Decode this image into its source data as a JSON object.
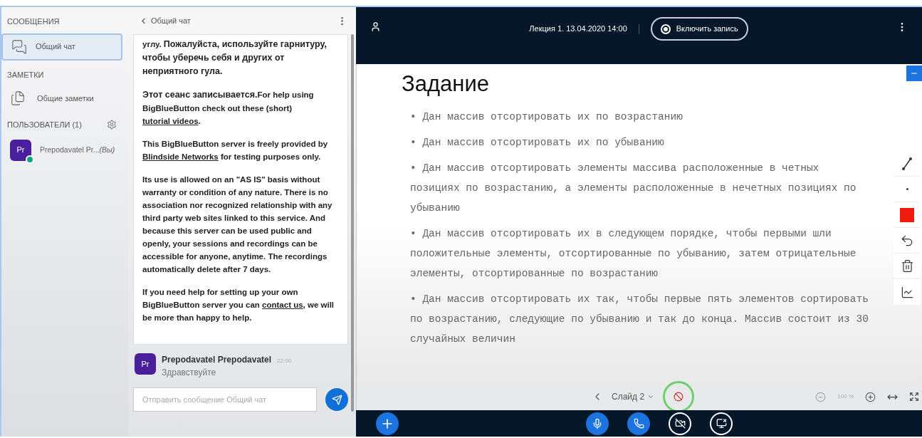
{
  "sidebar": {
    "messages_heading": "СООБЩЕНИЯ",
    "chats": [
      {
        "label": "Общий чат",
        "selected": true
      }
    ],
    "notes_heading": "ЗАМЕТКИ",
    "notes": [
      {
        "label": "Общие заметки"
      }
    ],
    "users_heading": "ПОЛЬЗОВАТЕЛИ (1)",
    "users": [
      {
        "avatar": "Pr",
        "name": "Prepodavatel Pr...",
        "suffix": "(Вы)"
      }
    ]
  },
  "chat": {
    "title": "Общий чат",
    "welcome": [
      [
        {
          "kind": "plain",
          "text": "углу. "
        },
        {
          "kind": "bold",
          "text": "Пожалуйста, используйте гарнитуру, чтобы уберечь себя и других от неприятного гула."
        }
      ],
      [
        {
          "kind": "bold",
          "text": "Этот сеанс записывается."
        },
        {
          "kind": "plain",
          "text": "For help using BigBlueButton check out these (short) "
        },
        {
          "kind": "link",
          "text": "tutorial videos"
        },
        {
          "kind": "plain",
          "text": "."
        }
      ],
      [
        {
          "kind": "plain",
          "text": "This BigBlueButton server is freely provided by "
        },
        {
          "kind": "link",
          "text": "Blindside Networks"
        },
        {
          "kind": "plain",
          "text": " for testing purposes only."
        }
      ],
      [
        {
          "kind": "plain",
          "text": "Its use is allowed on an \"AS IS\" basis without warranty or condition of any nature. There is no association nor recognized relationship with any third party web sites linked to this service. And because this server can be used public and openly, your sessions and recordings can be accessible for anyone, anytime. The recordings automatically delete after 7 days."
        }
      ],
      [
        {
          "kind": "plain",
          "text": "If you need help for setting up your own BigBlueButton server you can "
        },
        {
          "kind": "link",
          "text": "contact us"
        },
        {
          "kind": "plain",
          "text": ", we will be more than happy to help."
        }
      ]
    ],
    "messages": [
      {
        "avatar": "Pr",
        "author": "Prepodavatel Prepodavatel",
        "time": "22:00",
        "text": "Здравствуйте"
      }
    ],
    "input": {
      "placeholder": "Отправить сообщение Общий чат"
    }
  },
  "header": {
    "title": "Лекция 1. 13.04.2020 14:00",
    "record_button": "Включить запись"
  },
  "slide": {
    "title": "Задание",
    "items": [
      "• Дан массив отсортировать их по возрастанию",
      "• Дан массив отсортировать их по убыванию",
      "• Дан массив отсортировать элементы массива расположенные в четных позициях по возрастанию, а элементы расположенные в нечетных позициях по убыванию",
      "• Дан массив отсортировать их в следующем порядке, чтобы первыми шли положительные элементы, отсортированные по убыванию, затем отрицательные элементы, отсортированные по возрастанию",
      "• Дан массив отсортировать их так, чтобы первые пять элементов сортировать по возрастанию, следующие по убыванию и так до конца. Массив состоит из 30 случайных величин"
    ]
  },
  "slide_nav": {
    "label": "Слайд 2",
    "zoom": "100 %"
  }
}
